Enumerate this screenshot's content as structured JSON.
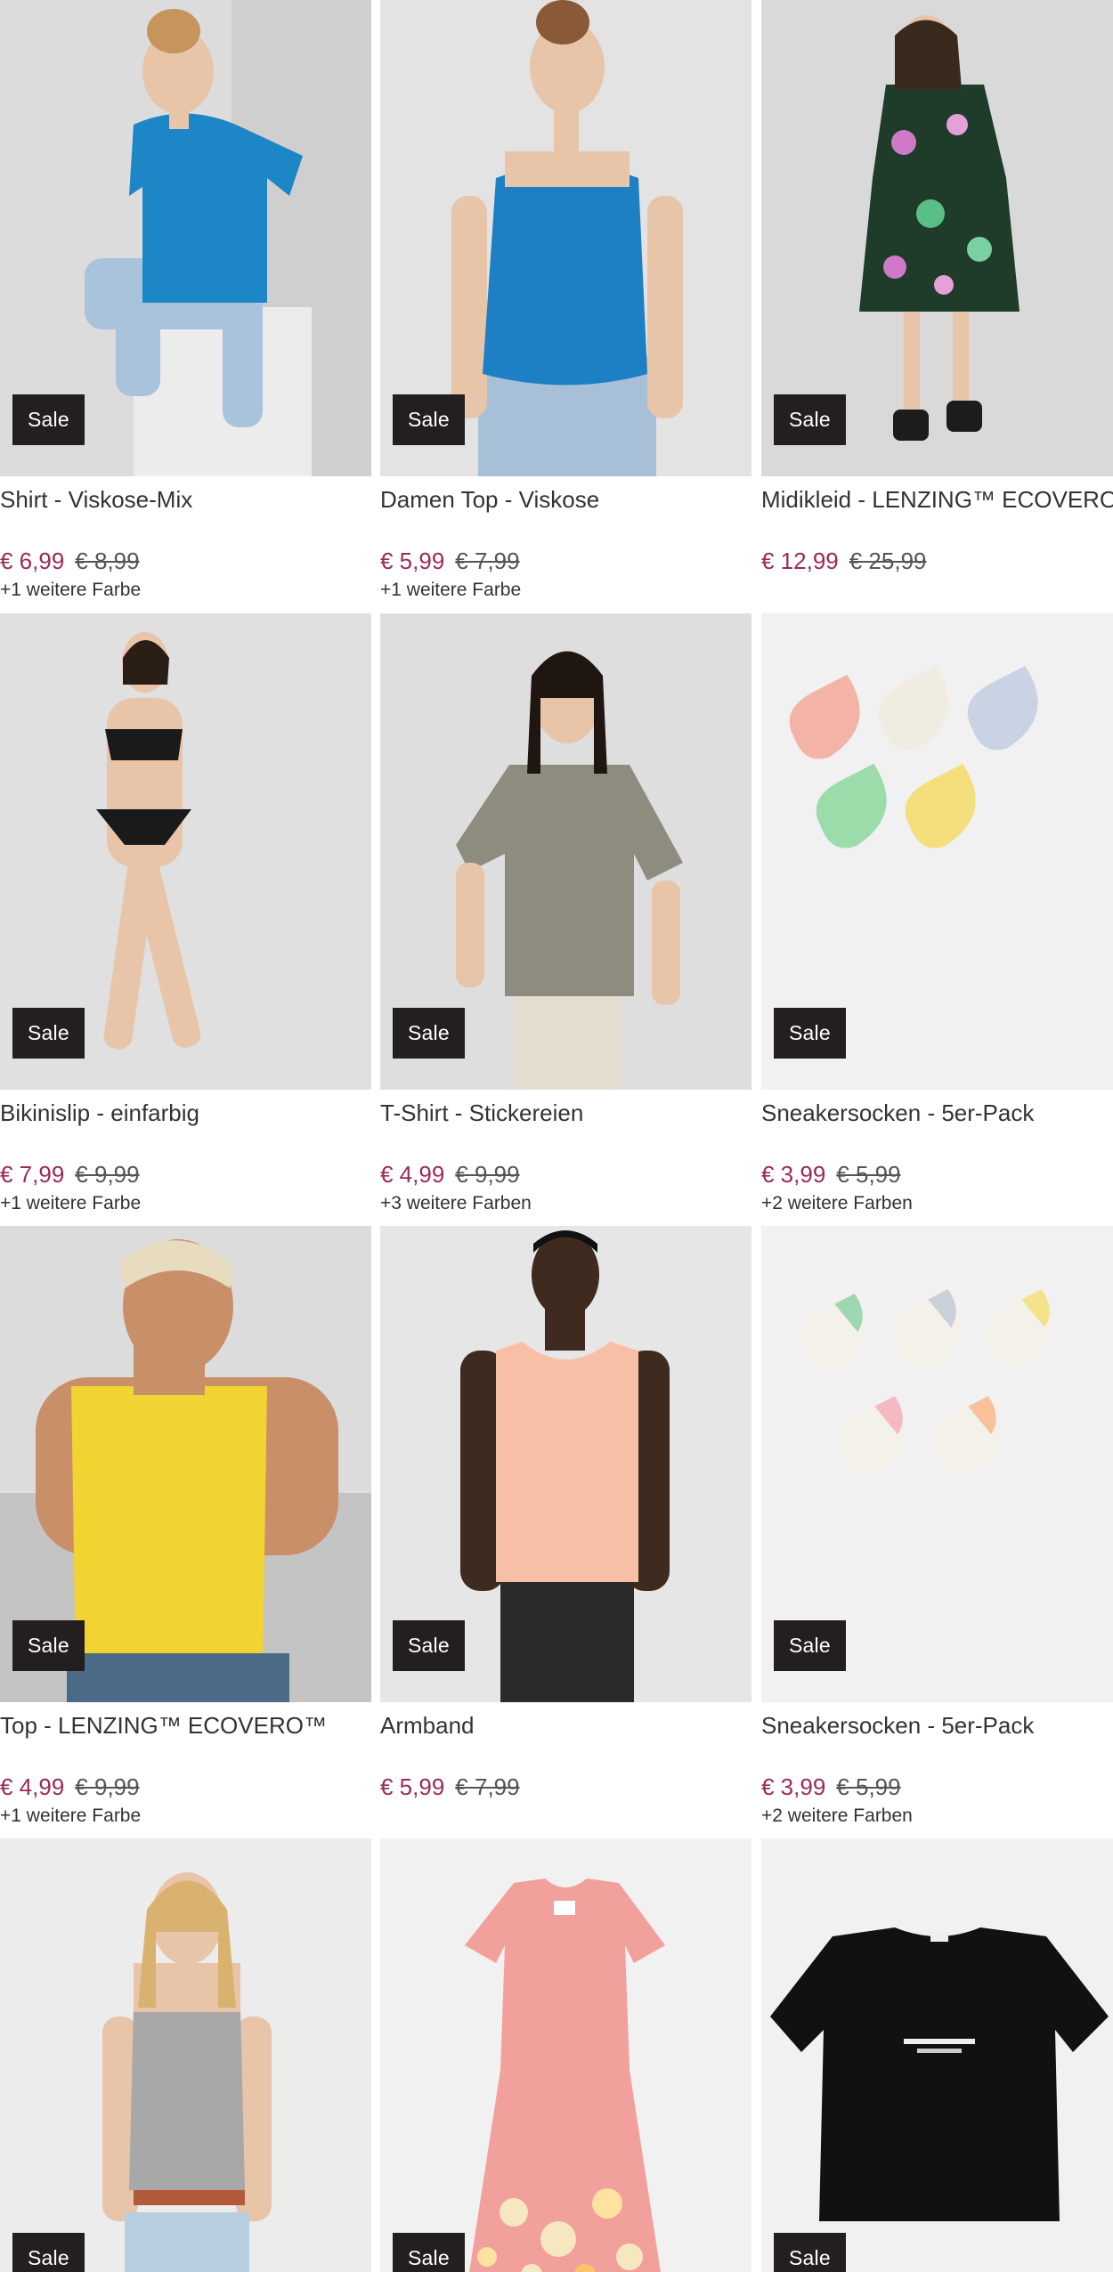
{
  "sale_label": "Sale",
  "products": [
    {
      "title": "Shirt - Viskose-Mix",
      "price": "€ 6,99",
      "old_price": "€ 8,99",
      "colors": "+1 weitere Farbe",
      "image": "woman-blue-shirt"
    },
    {
      "title": "Damen Top - Viskose",
      "price": "€ 5,99",
      "old_price": "€ 7,99",
      "colors": "+1 weitere Farbe",
      "image": "woman-blue-top"
    },
    {
      "title": "Midikleid - LENZING™ ECOVERO™",
      "price": "€ 12,99",
      "old_price": "€ 25,99",
      "colors": "",
      "image": "woman-floral-dress"
    },
    {
      "title": "Bikinislip - einfarbig",
      "price": "€ 7,99",
      "old_price": "€ 9,99",
      "colors": "+1 weitere Farbe",
      "image": "woman-black-bikini"
    },
    {
      "title": "T-Shirt - Stickereien",
      "price": "€ 4,99",
      "old_price": "€ 9,99",
      "colors": "+3 weitere Farben",
      "image": "woman-khaki-tshirt"
    },
    {
      "title": "Sneakersocken - 5er-Pack",
      "price": "€ 3,99",
      "old_price": "€ 5,99",
      "colors": "+2 weitere Farben",
      "image": "smiley-socks"
    },
    {
      "title": "Top - LENZING™ ECOVERO™",
      "price": "€ 4,99",
      "old_price": "€ 9,99",
      "colors": "+1 weitere Farbe",
      "image": "woman-yellow-top"
    },
    {
      "title": "Armband",
      "price": "€ 5,99",
      "old_price": "€ 7,99",
      "colors": "",
      "image": "man-peach-tank"
    },
    {
      "title": "Sneakersocken - 5er-Pack",
      "price": "€ 3,99",
      "old_price": "€ 5,99",
      "colors": "+2 weitere Farben",
      "image": "pastel-socks"
    },
    {
      "title": "",
      "price": "",
      "old_price": "",
      "colors": "",
      "image": "woman-grey-tank"
    },
    {
      "title": "",
      "price": "",
      "old_price": "",
      "colors": "",
      "image": "pink-kids-dress"
    },
    {
      "title": "",
      "price": "",
      "old_price": "",
      "colors": "",
      "image": "black-tshirt"
    }
  ]
}
